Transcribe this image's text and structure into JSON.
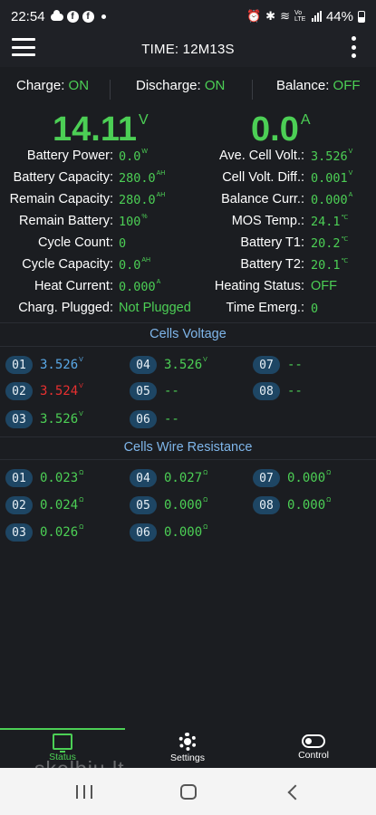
{
  "status_bar": {
    "time": "22:54",
    "battery": "44%",
    "network": "Vo LTE"
  },
  "app_bar": {
    "title": "TIME: 12M13S"
  },
  "switches": [
    {
      "label": "Charge:",
      "value": "ON"
    },
    {
      "label": "Discharge:",
      "value": "ON"
    },
    {
      "label": "Balance:",
      "value": "OFF"
    }
  ],
  "summary": {
    "voltage": "14.11",
    "voltage_unit": "V",
    "current": "0.0",
    "current_unit": "A"
  },
  "left_metrics": [
    {
      "label": "Battery Power:",
      "value": "0.0",
      "unit": "W"
    },
    {
      "label": "Battery Capacity:",
      "value": "280.0",
      "unit": "AH"
    },
    {
      "label": "Remain Capacity:",
      "value": "280.0",
      "unit": "AH"
    },
    {
      "label": "Remain Battery:",
      "value": "100",
      "unit": "%"
    },
    {
      "label": "Cycle Count:",
      "value": "0",
      "unit": ""
    },
    {
      "label": "Cycle Capacity:",
      "value": "0.0",
      "unit": "AH"
    },
    {
      "label": "Heat Current:",
      "value": "0.000",
      "unit": "A"
    },
    {
      "label": "Charg. Plugged:",
      "value": "Not Plugged",
      "unit": ""
    }
  ],
  "right_metrics": [
    {
      "label": "Ave. Cell Volt.:",
      "value": "3.526",
      "unit": "V"
    },
    {
      "label": "Cell Volt. Diff.:",
      "value": "0.001",
      "unit": "V"
    },
    {
      "label": "Balance Curr.:",
      "value": "0.000",
      "unit": "A"
    },
    {
      "label": "MOS Temp.:",
      "value": "24.1",
      "unit": "℃"
    },
    {
      "label": "Battery T1:",
      "value": "20.2",
      "unit": "℃"
    },
    {
      "label": "Battery T2:",
      "value": "20.1",
      "unit": "℃"
    },
    {
      "label": "Heating Status:",
      "value": "OFF",
      "unit": ""
    },
    {
      "label": "Time Emerg.:",
      "value": "0",
      "unit": ""
    }
  ],
  "cells_voltage": {
    "title": "Cells Voltage",
    "cells": [
      {
        "id": "01",
        "value": "3.526",
        "unit": "V",
        "color": "#5aa8e6"
      },
      {
        "id": "02",
        "value": "3.524",
        "unit": "V",
        "color": "#e83030"
      },
      {
        "id": "03",
        "value": "3.526",
        "unit": "V",
        "color": "#4ccf55"
      },
      {
        "id": "04",
        "value": "3.526",
        "unit": "V",
        "color": "#4ccf55"
      },
      {
        "id": "05",
        "value": "--",
        "unit": "",
        "color": "#4ccf55"
      },
      {
        "id": "06",
        "value": "--",
        "unit": "",
        "color": "#4ccf55"
      },
      {
        "id": "07",
        "value": "--",
        "unit": "",
        "color": "#4ccf55"
      },
      {
        "id": "08",
        "value": "--",
        "unit": "",
        "color": "#4ccf55"
      }
    ]
  },
  "cells_resistance": {
    "title": "Cells Wire Resistance",
    "cells": [
      {
        "id": "01",
        "value": "0.023",
        "unit": "Ω"
      },
      {
        "id": "02",
        "value": "0.024",
        "unit": "Ω"
      },
      {
        "id": "03",
        "value": "0.026",
        "unit": "Ω"
      },
      {
        "id": "04",
        "value": "0.027",
        "unit": "Ω"
      },
      {
        "id": "05",
        "value": "0.000",
        "unit": "Ω"
      },
      {
        "id": "06",
        "value": "0.000",
        "unit": "Ω"
      },
      {
        "id": "07",
        "value": "0.000",
        "unit": "Ω"
      },
      {
        "id": "08",
        "value": "0.000",
        "unit": "Ω"
      }
    ]
  },
  "bottom_nav": [
    {
      "label": "Status",
      "icon": "monitor-icon",
      "active": true
    },
    {
      "label": "Settings",
      "icon": "gear-icon",
      "active": false
    },
    {
      "label": "Control",
      "icon": "toggle-icon",
      "active": false
    }
  ],
  "watermark": "skelbiu.lt",
  "colors": {
    "accent_green": "#4ccf55",
    "accent_blue": "#7fb6ea",
    "warning_red": "#e83030",
    "badge_bg": "#1e4664"
  }
}
